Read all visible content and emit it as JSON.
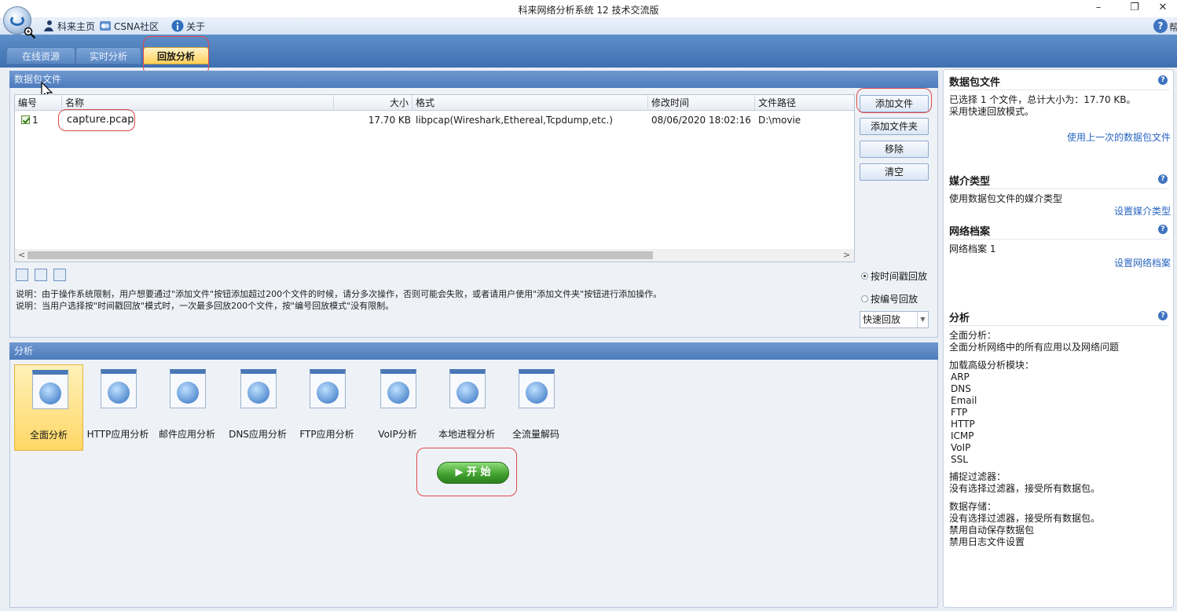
{
  "window": {
    "title": "科来网络分析系统 12 技术交流版",
    "min": "–",
    "max": "❐",
    "close": "✕"
  },
  "quickbar": {
    "home": "科来主页",
    "community": "CSNA社区",
    "about": "关于",
    "help_label": "帮"
  },
  "tabs": {
    "online": "在线资源",
    "realtime": "实时分析",
    "replay": "回放分析"
  },
  "files": {
    "section_title": "数据包文件",
    "columns": {
      "no": "编号",
      "name": "名称",
      "size": "大小",
      "format": "格式",
      "mtime": "修改时间",
      "path": "文件路径"
    },
    "rows": [
      {
        "no": "1",
        "name": "capture.pcap",
        "size": "17.70 KB",
        "format": "libpcap(Wireshark,Ethereal,Tcpdump,etc.)",
        "mtime": "08/06/2020 18:02:16",
        "path": "D:\\movie"
      }
    ],
    "buttons": {
      "add_file": "添加文件",
      "add_folder": "添加文件夹",
      "remove": "移除",
      "clear": "清空"
    },
    "notes": [
      "说明：由于操作系统限制，用户想要通过\"添加文件\"按钮添加超过200个文件的时候，请分多次操作，否则可能会失败，或者请用户使用\"添加文件夹\"按钮进行添加操作。",
      "说明：当用户选择按\"时间戳回放\"模式时，一次最多回放200个文件，按\"编号回放模式\"没有限制。"
    ],
    "replay_modes": {
      "by_time": "按时间戳回放",
      "by_number": "按编号回放"
    },
    "speed": "快速回放"
  },
  "analysis": {
    "section_title": "分析",
    "modules": [
      {
        "label": "全面分析",
        "icon": "magnifier-icon"
      },
      {
        "label": "HTTP应用分析",
        "icon": "globe-icon"
      },
      {
        "label": "邮件应用分析",
        "icon": "mail-icon"
      },
      {
        "label": "DNS应用分析",
        "icon": "dns-icon"
      },
      {
        "label": "FTP应用分析",
        "icon": "ftp-icon"
      },
      {
        "label": "VoIP分析",
        "icon": "headset-icon"
      },
      {
        "label": "本地进程分析",
        "icon": "process-icon"
      },
      {
        "label": "全流量解码",
        "icon": "microscope-icon"
      }
    ],
    "start": "▶ 开 始"
  },
  "side": {
    "files_title": "数据包文件",
    "files_info1": "已选择 1 个文件，总计大小为：17.70 KB。",
    "files_info2": "采用快速回放模式。",
    "files_link": "使用上一次的数据包文件",
    "media_title": "媒介类型",
    "media_info": "使用数据包文件的媒介类型",
    "media_link": "设置媒介类型",
    "profile_title": "网络档案",
    "profile_info": "网络档案 1",
    "profile_link": "设置网络档案",
    "analysis_title": "分析",
    "analysis_lines": [
      "全面分析：",
      "全面分析网络中的所有应用以及网络问题",
      "加载高级分析模块：",
      "ARP",
      "DNS",
      "Email",
      "FTP",
      "HTTP",
      "ICMP",
      "VoIP",
      "SSL",
      "捕捉过滤器：",
      "没有选择过滤器，接受所有数据包。",
      "数据存储：",
      "没有选择过滤器，接受所有数据包。",
      "禁用自动保存数据包",
      "禁用日志文件设置"
    ]
  }
}
